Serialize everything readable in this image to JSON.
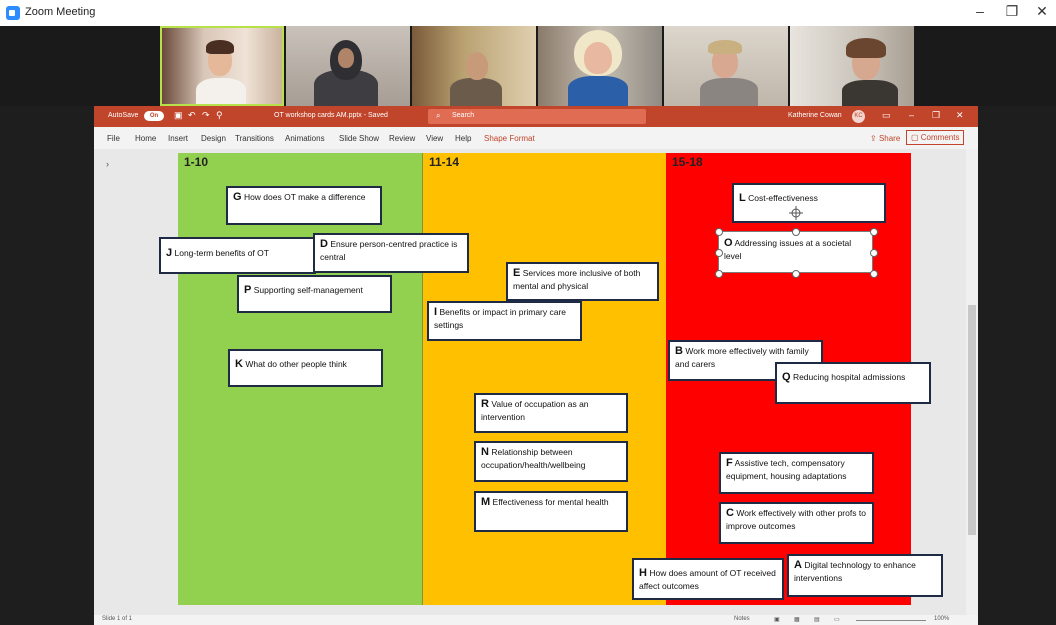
{
  "zoom": {
    "title": "Zoom Meeting",
    "minimize": "–",
    "restore": "❐",
    "close": "✕"
  },
  "powerpoint": {
    "autosave_label": "AutoSave",
    "autosave_state": "On",
    "doc_title": "OT workshop cards AM.pptx - Saved",
    "search_placeholder": "Search",
    "user_name": "Katherine Cowan",
    "user_initials": "KC",
    "menu": [
      "File",
      "Home",
      "Insert",
      "Design",
      "Transitions",
      "Animations",
      "Slide Show",
      "Review",
      "View",
      "Help",
      "Shape Format"
    ],
    "share_label": "Share",
    "comments_label": "Comments",
    "status": {
      "slide": "Slide 1 of 1",
      "notes": "Notes",
      "zoom": "100%"
    }
  },
  "slide": {
    "columns": [
      {
        "label": "1-10",
        "color": "#92d050"
      },
      {
        "label": "11-14",
        "color": "#ffc000"
      },
      {
        "label": "15-18",
        "color": "#ff0000"
      }
    ],
    "cards": {
      "g": {
        "letter": "G",
        "text": "How does OT make a difference"
      },
      "j": {
        "letter": "J",
        "text": "Long-term benefits of OT"
      },
      "d": {
        "letter": "D",
        "text": "Ensure person-centred practice is central"
      },
      "p": {
        "letter": "P",
        "text": "Supporting self-management"
      },
      "k": {
        "letter": "K",
        "text": "What do other people think"
      },
      "e": {
        "letter": "E",
        "text": "Services more inclusive of both mental and physical"
      },
      "i": {
        "letter": "I",
        "text": "Benefits or impact in primary care settings"
      },
      "r": {
        "letter": "R",
        "text": "Value of occupation as an intervention"
      },
      "n": {
        "letter": "N",
        "text": "Relationship between occupation/health/wellbeing"
      },
      "m": {
        "letter": "M",
        "text": "Effectiveness for mental health"
      },
      "h": {
        "letter": "H",
        "text": "How does amount of OT received affect outcomes"
      },
      "l": {
        "letter": "L",
        "text": "Cost-effectiveness"
      },
      "o": {
        "letter": "O",
        "text": "Addressing issues at a societal level"
      },
      "b": {
        "letter": "B",
        "text": "Work more effectively with family and carers"
      },
      "q": {
        "letter": "Q",
        "text": "Reducing hospital admissions"
      },
      "f": {
        "letter": "F",
        "text": "Assistive tech, compensatory equipment, housing adaptations"
      },
      "c": {
        "letter": "C",
        "text": "Work effectively with other profs to improve outcomes"
      },
      "a": {
        "letter": "A",
        "text": "Digital technology to enhance interventions"
      }
    }
  }
}
